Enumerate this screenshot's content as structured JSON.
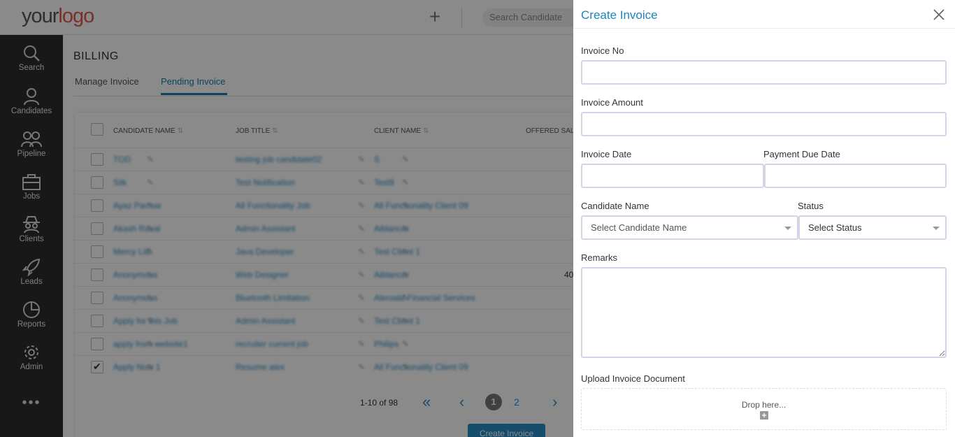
{
  "header": {
    "logo_part1": "your",
    "logo_part2": "logo",
    "add_symbol": "+",
    "search_placeholder": "Search Candidate"
  },
  "sidenav": {
    "items": [
      {
        "label": "Search",
        "icon": "search-icon"
      },
      {
        "label": "Candidates",
        "icon": "person-icon"
      },
      {
        "label": "Pipeline",
        "icon": "people-icon"
      },
      {
        "label": "Jobs",
        "icon": "briefcase-icon"
      },
      {
        "label": "Clients",
        "icon": "spy-icon"
      },
      {
        "label": "Leads",
        "icon": "rocket-icon"
      },
      {
        "label": "Reports",
        "icon": "pie-chart-icon"
      },
      {
        "label": "Admin",
        "icon": "gear-icon"
      }
    ],
    "more": "•••"
  },
  "main": {
    "title": "BILLING",
    "tabs": [
      {
        "label": "Manage Invoice",
        "active": false
      },
      {
        "label": "Pending Invoice",
        "active": true
      }
    ],
    "columns": [
      "CANDIDATE NAME",
      "JOB TITLE",
      "CLIENT NAME",
      "OFFERED SAL"
    ],
    "rows": [
      {
        "candidate": "TOD",
        "job": "testing job candidate02",
        "client": "S",
        "checked": false,
        "salary": ""
      },
      {
        "candidate": "Silk",
        "job": "Test Notification",
        "client": "Test9",
        "checked": false,
        "salary": ""
      },
      {
        "candidate": "Ayaz Parmar",
        "job": "All Functionality Job",
        "client": "All Functionality Client 09",
        "checked": false,
        "salary": ""
      },
      {
        "candidate": "Akash Raval",
        "job": "Admin Assistant",
        "client": "Aiblancer",
        "checked": false,
        "salary": ""
      },
      {
        "candidate": "Mercy Lilli",
        "job": "Java Developer",
        "client": "Test Client 1",
        "checked": false,
        "salary": ""
      },
      {
        "candidate": "Anonymous",
        "job": "Web Designer",
        "client": "Aiblancer",
        "checked": false,
        "salary": "40"
      },
      {
        "candidate": "Anonymous",
        "job": "Bluetooth Limitation",
        "client": "Aleroald Financial Services",
        "checked": false,
        "salary": ""
      },
      {
        "candidate": "Apply for this Job",
        "job": "Admin Assistant",
        "client": "Test Client 1",
        "checked": false,
        "salary": ""
      },
      {
        "candidate": "apply from website1",
        "job": "recruiter current job",
        "client": "Philips",
        "checked": false,
        "salary": ""
      },
      {
        "candidate": "Apply Now 1",
        "job": "Resume alex",
        "client": "All Functionality Client 09",
        "checked": true,
        "salary": ""
      }
    ],
    "pager": {
      "count": "1-10 of 98",
      "first": "«",
      "prev": "‹",
      "current": "1",
      "page2": "2",
      "next": "›"
    },
    "create_button": "Create Invoice"
  },
  "drawer": {
    "title": "Create Invoice",
    "invoice_no_label": "Invoice No",
    "invoice_no_value": "",
    "invoice_amount_label": "Invoice Amount",
    "invoice_amount_value": "",
    "invoice_date_label": "Invoice Date",
    "payment_due_label": "Payment Due Date",
    "candidate_name_label": "Candidate Name",
    "candidate_name_placeholder": "Select Candidate Name",
    "status_label": "Status",
    "status_placeholder": "Select Status",
    "remarks_label": "Remarks",
    "upload_label": "Upload Invoice Document",
    "drop_text": "Drop here...",
    "drop_plus": "+"
  },
  "colors": {
    "accent": "#1b86b8",
    "nav_bg": "#2e2e2e",
    "logo_red": "#e2574c",
    "input_border": "#d4d4e8"
  }
}
